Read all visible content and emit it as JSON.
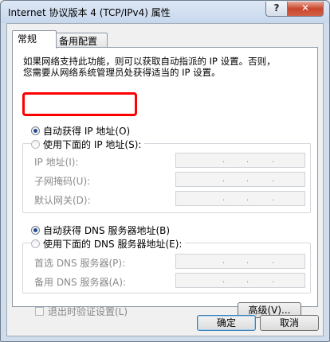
{
  "window": {
    "title": "Internet 协议版本 4 (TCP/IPv4) 属性",
    "help_label": "?",
    "close_label": "✕"
  },
  "tabs": [
    {
      "label": "常规"
    },
    {
      "label": "备用配置"
    }
  ],
  "description": {
    "line1": "如果网络支持此功能，则可以获取自动指派的 IP 设置。否则，",
    "line2": "您需要从网络系统管理员处获得适当的 IP 设置。"
  },
  "ip": {
    "auto_label": "自动获得 IP 地址(O)",
    "manual_label": "使用下面的 IP 地址(S):",
    "fields": [
      {
        "label": "IP 地址(I):"
      },
      {
        "label": "子网掩码(U):"
      },
      {
        "label": "默认网关(D):"
      }
    ]
  },
  "dns": {
    "auto_label": "自动获得 DNS 服务器地址(B)",
    "manual_label": "使用下面的 DNS 服务器地址(E):",
    "fields": [
      {
        "label": "首选 DNS 服务器(P):"
      },
      {
        "label": "备用 DNS 服务器(A):"
      }
    ]
  },
  "validate_label": "退出时验证设置(L)",
  "advanced_label": "高级(V)...",
  "ok_label": "确定",
  "cancel_label": "取消",
  "colors": {
    "highlight": "#ff0000",
    "close": "#c8462c",
    "radio_selected": "#214a92"
  }
}
